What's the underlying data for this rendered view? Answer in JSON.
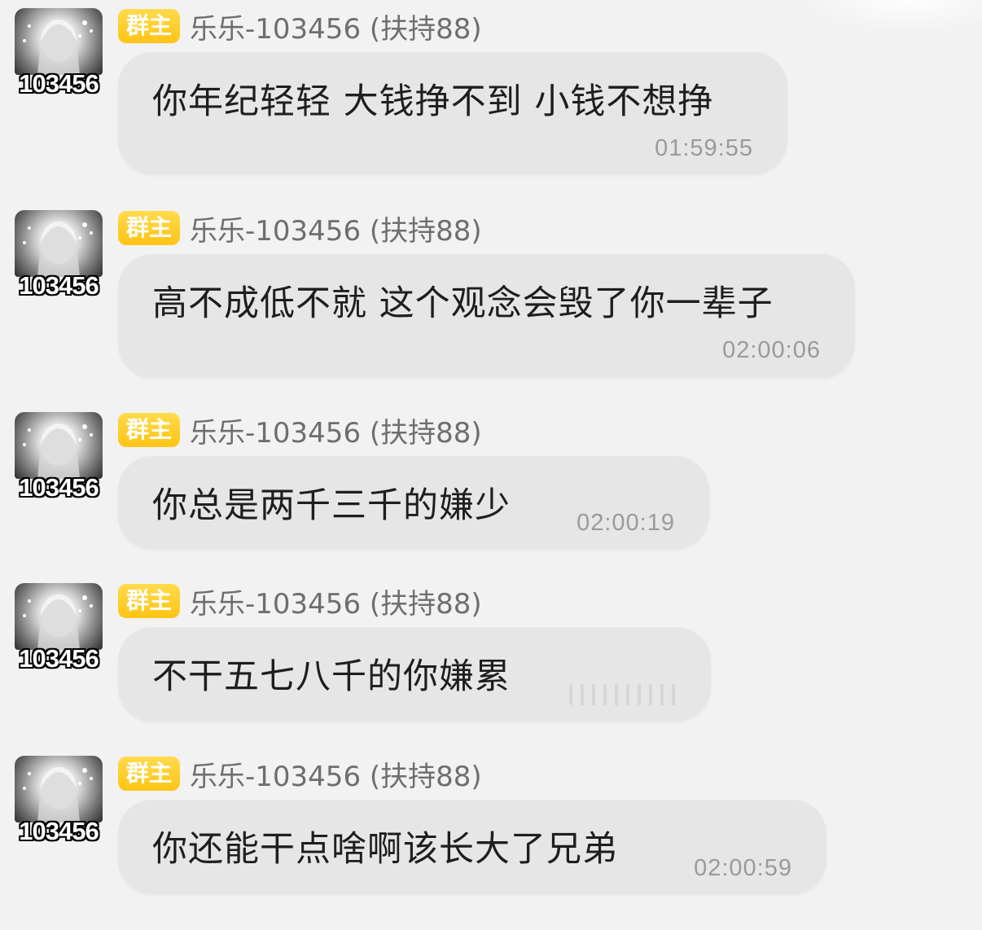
{
  "messages": [
    {
      "avatar_id": "103456",
      "badge": "群主",
      "sender": "乐乐-103456 (扶持88)",
      "text": "你年纪轻轻 大钱挣不到 小钱不想挣",
      "time": "01:59:55"
    },
    {
      "avatar_id": "103456",
      "badge": "群主",
      "sender": "乐乐-103456 (扶持88)",
      "text": "高不成低不就 这个观念会毁了你一辈子",
      "time": "02:00:06"
    },
    {
      "avatar_id": "103456",
      "badge": "群主",
      "sender": "乐乐-103456 (扶持88)",
      "text": "你总是两千三千的嫌少",
      "time": "02:00:19"
    },
    {
      "avatar_id": "103456",
      "badge": "群主",
      "sender": "乐乐-103456 (扶持88)",
      "text": "不干五七八千的你嫌累",
      "time": ""
    },
    {
      "avatar_id": "103456",
      "badge": "群主",
      "sender": "乐乐-103456 (扶持88)",
      "text": "你还能干点啥啊该长大了兄弟",
      "time": "02:00:59"
    }
  ]
}
